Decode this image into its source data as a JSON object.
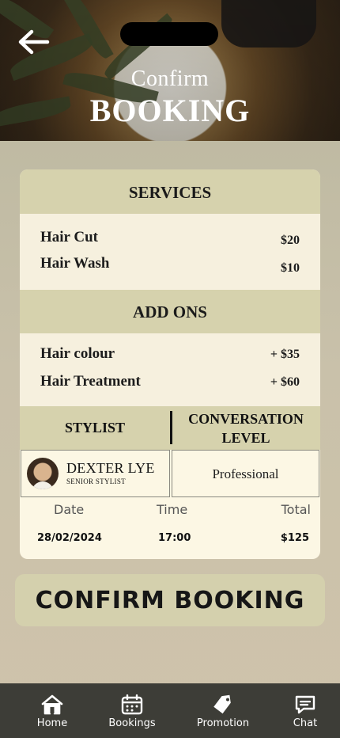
{
  "header": {
    "title_small": "Confirm",
    "title_big": "BOOKING"
  },
  "services": {
    "heading": "SERVICES",
    "items": [
      {
        "name": "Hair Cut",
        "price": "$20"
      },
      {
        "name": "Hair Wash",
        "price": "$10"
      }
    ]
  },
  "addons": {
    "heading": "ADD ONS",
    "items": [
      {
        "name": "Hair colour",
        "price": "+ $35"
      },
      {
        "name": "Hair Treatment",
        "price": "+ $60"
      }
    ]
  },
  "stylist": {
    "heading": "STYLIST",
    "name": "DEXTER LYE",
    "role": "SENIOR STYLIST"
  },
  "conversation": {
    "heading_line1": "CONVERSATION",
    "heading_line2": "LEVEL",
    "value": "Professional"
  },
  "summary": {
    "date_label": "Date",
    "date_value": "28/02/2024",
    "time_label": "Time",
    "time_value": "17:00",
    "total_label": "Total",
    "total_value": "$125"
  },
  "confirm_button": "CONFIRM BOOKING",
  "tabbar": {
    "items": [
      {
        "label": "Home",
        "icon": "home-icon"
      },
      {
        "label": "Bookings",
        "icon": "calendar-icon"
      },
      {
        "label": "Promotion",
        "icon": "tag-icon"
      },
      {
        "label": "Chat",
        "icon": "chat-icon"
      }
    ]
  },
  "colors": {
    "band": "#d6d2ad",
    "card": "#fcf7e4",
    "tabbar": "#3d3d37"
  }
}
